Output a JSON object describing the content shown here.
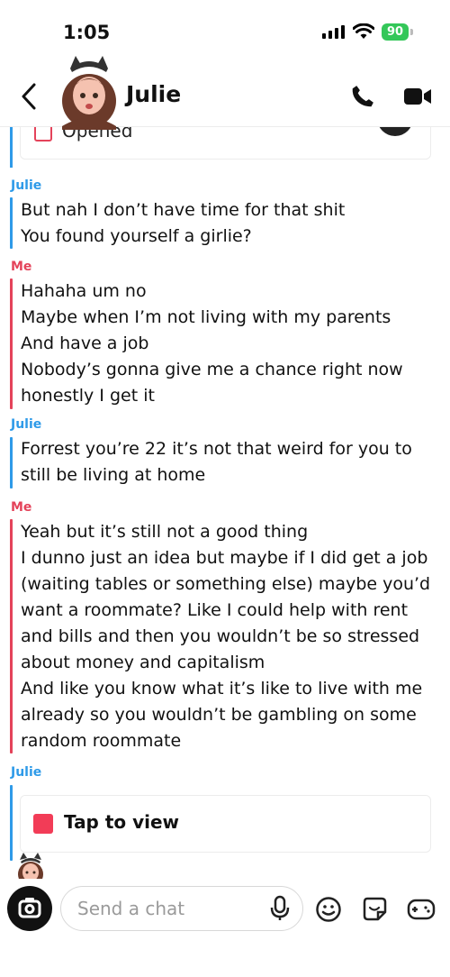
{
  "status_bar": {
    "time": "1:05",
    "battery": "90"
  },
  "header": {
    "contact_name": "Julie"
  },
  "opened_card": {
    "label": "Opened"
  },
  "messages": [
    {
      "sender": "Julie",
      "lines": [
        "But nah I don’t have time for that shit",
        "You found yourself a girlie?"
      ]
    },
    {
      "sender": "Me",
      "lines": [
        "Hahaha um no",
        "Maybe when I’m not living with my parents",
        "And have a job",
        "Nobody’s gonna give me a chance right now",
        "honestly I get it"
      ]
    },
    {
      "sender": "Julie",
      "lines": [
        "Forrest you’re 22 it’s not that weird for you to still be living at home"
      ]
    },
    {
      "sender": "Me",
      "lines": [
        "Yeah but it’s still not a good thing",
        "I dunno just an idea but maybe if I did get a job (waiting tables or something else) maybe you’d want a roommate? Like I could help with rent and bills and then you wouldn’t be so stressed about money and capitalism",
        "And like you know what it’s like to live with me already so you wouldn’t be gambling on some random roommate"
      ]
    },
    {
      "sender": "Julie",
      "lines": []
    }
  ],
  "snap": {
    "label": "Tap to view"
  },
  "input": {
    "placeholder": "Send a chat"
  },
  "colors": {
    "julie": "#2e9ae8",
    "me": "#e4435a",
    "snap_red": "#f23c57",
    "battery_green": "#34c759"
  },
  "icons": [
    "back-chevron-icon",
    "phone-icon",
    "video-camera-icon",
    "camera-icon",
    "microphone-icon",
    "emoji-icon",
    "sticker-icon",
    "game-controller-icon"
  ]
}
